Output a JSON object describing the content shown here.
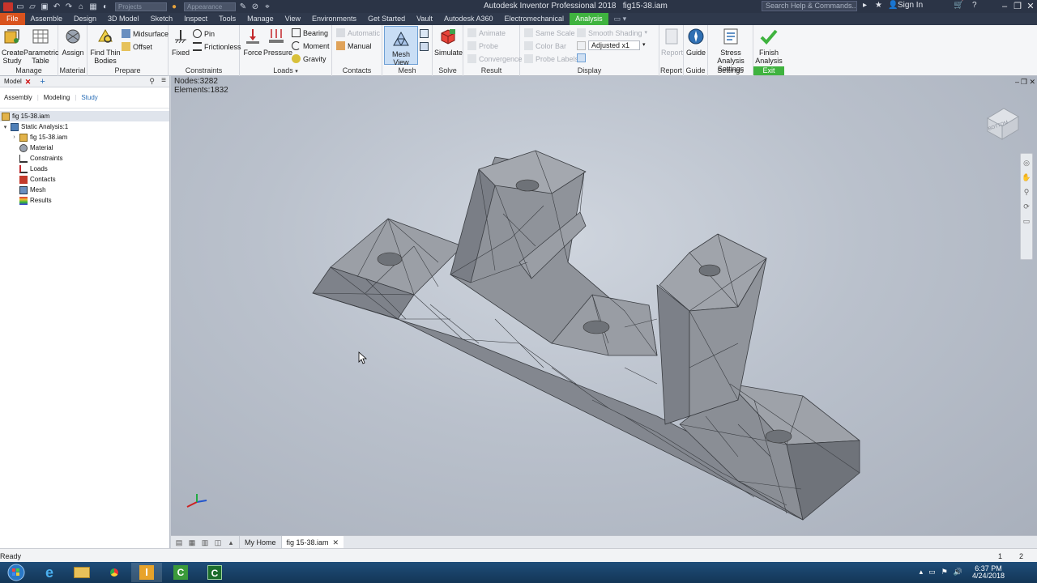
{
  "titlebar": {
    "app_title": "Autodesk Inventor Professional 2018",
    "doc_title": "fig15-38.iam",
    "combo1": "Projects",
    "combo2": "Appearance",
    "help_search_placeholder": "Search Help & Commands...",
    "sign_in": "Sign In"
  },
  "tabs": [
    "File",
    "Assemble",
    "Design",
    "3D Model",
    "Sketch",
    "Inspect",
    "Tools",
    "Manage",
    "View",
    "Environments",
    "Get Started",
    "Vault",
    "Autodesk A360",
    "Electromechanical",
    "Analysis"
  ],
  "ribbon": {
    "manage": {
      "title": "Manage",
      "create_study": "Create\nStudy",
      "parametric_table": "Parametric\nTable"
    },
    "material": {
      "title": "Material",
      "assign": "Assign"
    },
    "prepare": {
      "title": "Prepare",
      "find_thin": "Find Thin\nBodies",
      "midsurface": "Midsurface",
      "offset": "Offset"
    },
    "constraints": {
      "title": "Constraints",
      "fixed": "Fixed",
      "pin": "Pin",
      "frictionless": "Frictionless"
    },
    "loads": {
      "title": "Loads",
      "force": "Force",
      "pressure": "Pressure",
      "bearing": "Bearing",
      "moment": "Moment",
      "gravity": "Gravity"
    },
    "contacts": {
      "title": "Contacts",
      "automatic": "Automatic",
      "manual": "Manual"
    },
    "mesh": {
      "title": "Mesh",
      "mesh_view": "Mesh View"
    },
    "solve": {
      "title": "Solve",
      "simulate": "Simulate"
    },
    "result": {
      "title": "Result",
      "animate": "Animate",
      "probe": "Probe",
      "convergence": "Convergence"
    },
    "display": {
      "title": "Display",
      "same_scale": "Same Scale",
      "color_bar": "Color Bar",
      "probe_labels": "Probe Labels",
      "smooth_shading": "Smooth Shading",
      "adjusted": "Adjusted x1"
    },
    "report": {
      "title": "Report",
      "report": "Report"
    },
    "guide": {
      "title": "Guide",
      "guide": "Guide"
    },
    "settings": {
      "title": "Settings",
      "stress_settings": "Stress Analysis\nSettings"
    },
    "exit": {
      "title": "Exit",
      "finish": "Finish\nAnalysis"
    }
  },
  "browser": {
    "tab_model": "Model",
    "modes": [
      "Assembly",
      "Modeling",
      "Study"
    ],
    "tree": [
      {
        "label": "fig 15-38.iam",
        "level": 0,
        "icon": "assembly-icon"
      },
      {
        "label": "Static Analysis:1",
        "level": 1,
        "icon": "analysis-icon"
      },
      {
        "label": "fig 15-38.iam",
        "level": 2,
        "icon": "assembly-icon"
      },
      {
        "label": "Material",
        "level": 2,
        "icon": "material-icon"
      },
      {
        "label": "Constraints",
        "level": 2,
        "icon": "constraints-icon"
      },
      {
        "label": "Loads",
        "level": 2,
        "icon": "loads-icon"
      },
      {
        "label": "Contacts",
        "level": 2,
        "icon": "contacts-icon"
      },
      {
        "label": "Mesh",
        "level": 2,
        "icon": "mesh-icon"
      },
      {
        "label": "Results",
        "level": 2,
        "icon": "results-icon"
      }
    ]
  },
  "viewport": {
    "nodes": "Nodes:3282",
    "elements": "Elements:1832",
    "viewcube_label": "BOTTOM"
  },
  "doctabs": {
    "home": "My Home",
    "current": "fig 15-38.iam"
  },
  "status": {
    "text": "Ready",
    "n1": "1",
    "n2": "2"
  },
  "taskbar": {
    "time": "6:37 PM",
    "date": "4/24/2018"
  },
  "colors": {
    "file_tab": "#d9531e",
    "analysis_tab": "#3fb33f",
    "mesh_fill": "#8e9299",
    "mesh_line": "#3a3d42"
  }
}
